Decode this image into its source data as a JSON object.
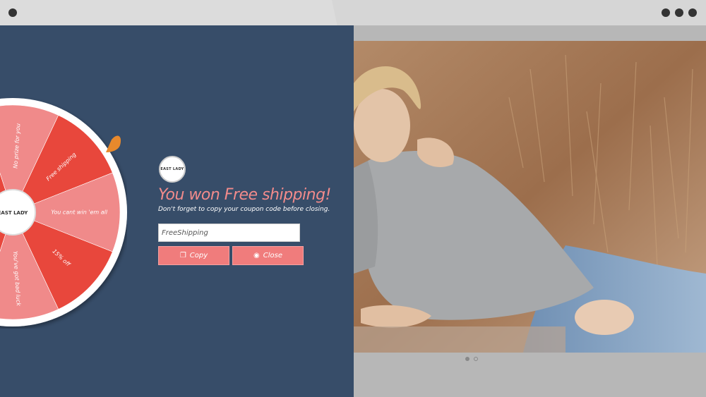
{
  "browser": {
    "window_dots": [
      "dot",
      "dot",
      "dot",
      "dot"
    ]
  },
  "wheel": {
    "segments": [
      {
        "label": "No prize for you",
        "color": "#f08a8a"
      },
      {
        "label": "Free shipping",
        "color": "#e8473c"
      },
      {
        "label": "You cant win 'em all",
        "color": "#f08a8a"
      },
      {
        "label": "15% off",
        "color": "#e8473c"
      },
      {
        "label": "You've got bad luck",
        "color": "#f08a8a"
      }
    ],
    "pointer_color": "#e8892c",
    "center_logo": "EAST LADY"
  },
  "popup": {
    "logo_text": "EAST LADY",
    "title": "You won Free shipping!",
    "subtitle": "Don't forget to copy your coupon code before closing.",
    "coupon_value": "FreeShipping",
    "copy_label": "Copy",
    "close_label": "Close"
  },
  "carousel": {
    "active_index": 0,
    "count": 2
  },
  "colors": {
    "panel_bg": "#374d69",
    "accent": "#f07c7c",
    "title": "#f28b8b"
  }
}
